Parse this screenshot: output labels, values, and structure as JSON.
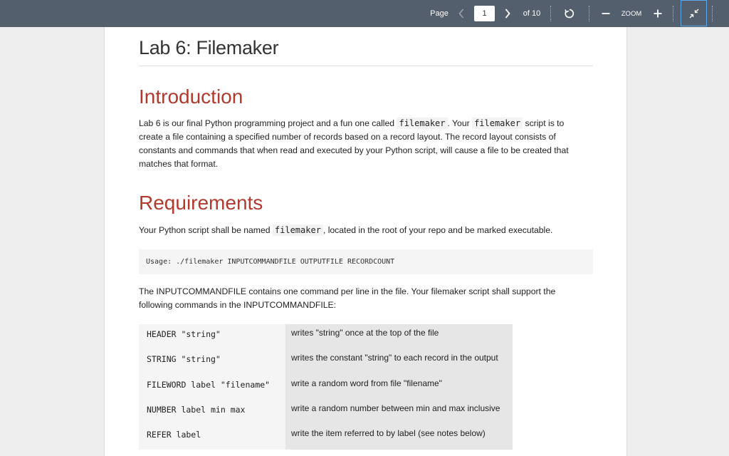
{
  "toolbar": {
    "page_label": "Page",
    "current_page": "1",
    "of_pages": "of 10",
    "zoom_label": "ZOOM"
  },
  "document": {
    "title": "Lab 6: Filemaker",
    "intro": {
      "heading": "Introduction",
      "p1_a": "Lab 6 is our final Python programming project and a fun one called ",
      "p1_code1": "filemaker",
      "p1_b": ". Your ",
      "p1_code2": "filemaker",
      "p1_c": " script is to create a file containing a specified number of records based on a record layout. The record layout consists of constants and commands that when read and executed by your Python script, will cause a file to be created that matches that format."
    },
    "requirements": {
      "heading": "Requirements",
      "p1_a": "Your Python script shall be named ",
      "p1_code": "filemaker",
      "p1_b": ", located in the root of your repo and be marked executable.",
      "usage": "Usage: ./filemaker INPUTCOMMANDFILE OUTPUTFILE RECORDCOUNT",
      "p2": "The INPUTCOMMANDFILE contains one command per line in the file. Your filemaker script shall support the following commands in the INPUTCOMMANDFILE:",
      "commands": [
        {
          "command": "HEADER \"string\"",
          "description": "writes \"string\" once at the top of the file"
        },
        {
          "command": "STRING \"string\"",
          "description": "writes the constant \"string\" to each record in the output"
        },
        {
          "command": "FILEWORD label \"filename\"",
          "description": "write a random word from file \"filename\""
        },
        {
          "command": "NUMBER label min max",
          "description": "write a random number between min and max inclusive"
        },
        {
          "command": "REFER label",
          "description": "write the item referred to by label (see notes below)"
        }
      ]
    }
  }
}
